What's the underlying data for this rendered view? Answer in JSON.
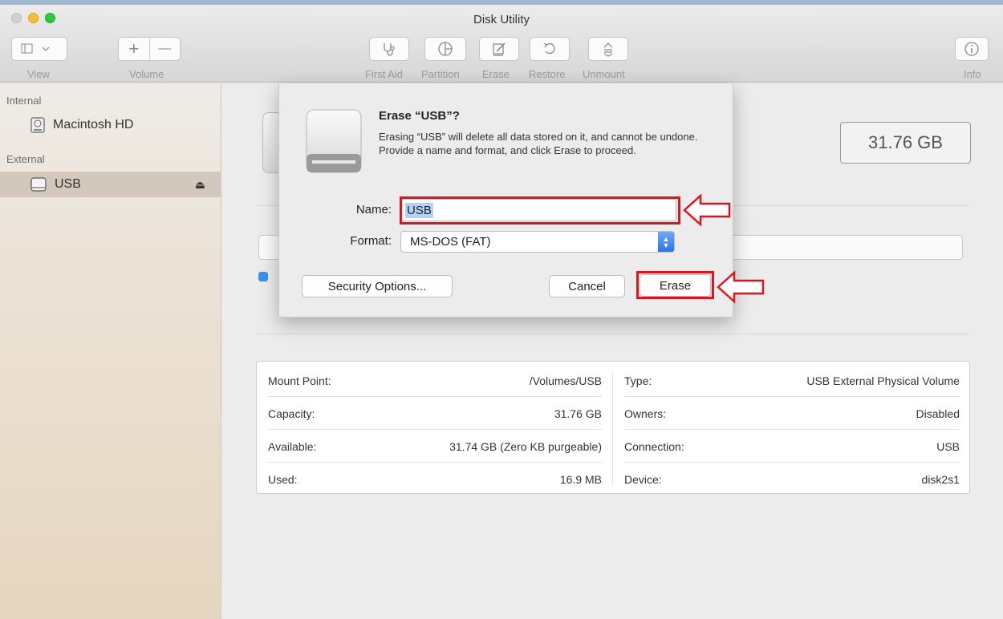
{
  "window": {
    "title": "Disk Utility"
  },
  "toolbar": {
    "view_label": "View",
    "volume_label": "Volume",
    "first_aid_label": "First Aid",
    "partition_label": "Partition",
    "erase_label": "Erase",
    "restore_label": "Restore",
    "unmount_label": "Unmount",
    "info_label": "Info",
    "add_symbol": "+",
    "remove_symbol": "—"
  },
  "sidebar": {
    "internal_header": "Internal",
    "internal_items": [
      {
        "label": "Macintosh HD",
        "icon": "internal-disk-icon"
      }
    ],
    "external_header": "External",
    "external_items": [
      {
        "label": "USB",
        "icon": "external-disk-icon",
        "selected": true
      }
    ]
  },
  "main": {
    "capacity_badge": "31.76 GB",
    "info_left": [
      {
        "key": "Mount Point:",
        "value": "/Volumes/USB"
      },
      {
        "key": "Capacity:",
        "value": "31.76 GB"
      },
      {
        "key": "Available:",
        "value": "31.74 GB (Zero KB purgeable)"
      },
      {
        "key": "Used:",
        "value": "16.9 MB"
      }
    ],
    "info_right": [
      {
        "key": "Type:",
        "value": "USB External Physical Volume"
      },
      {
        "key": "Owners:",
        "value": "Disabled"
      },
      {
        "key": "Connection:",
        "value": "USB"
      },
      {
        "key": "Device:",
        "value": "disk2s1"
      }
    ]
  },
  "sheet": {
    "title": "Erase “USB”?",
    "message": "Erasing “USB” will delete all data stored on it, and cannot be undone. Provide a name and format, and click Erase to proceed.",
    "name_label": "Name:",
    "name_value": "USB",
    "format_label": "Format:",
    "format_value": "MS-DOS (FAT)",
    "security_button": "Security Options...",
    "cancel_button": "Cancel",
    "erase_button": "Erase"
  },
  "colors": {
    "highlight": "#e0141e",
    "accent": "#2a74e8",
    "selection": "#b3d2f7"
  }
}
